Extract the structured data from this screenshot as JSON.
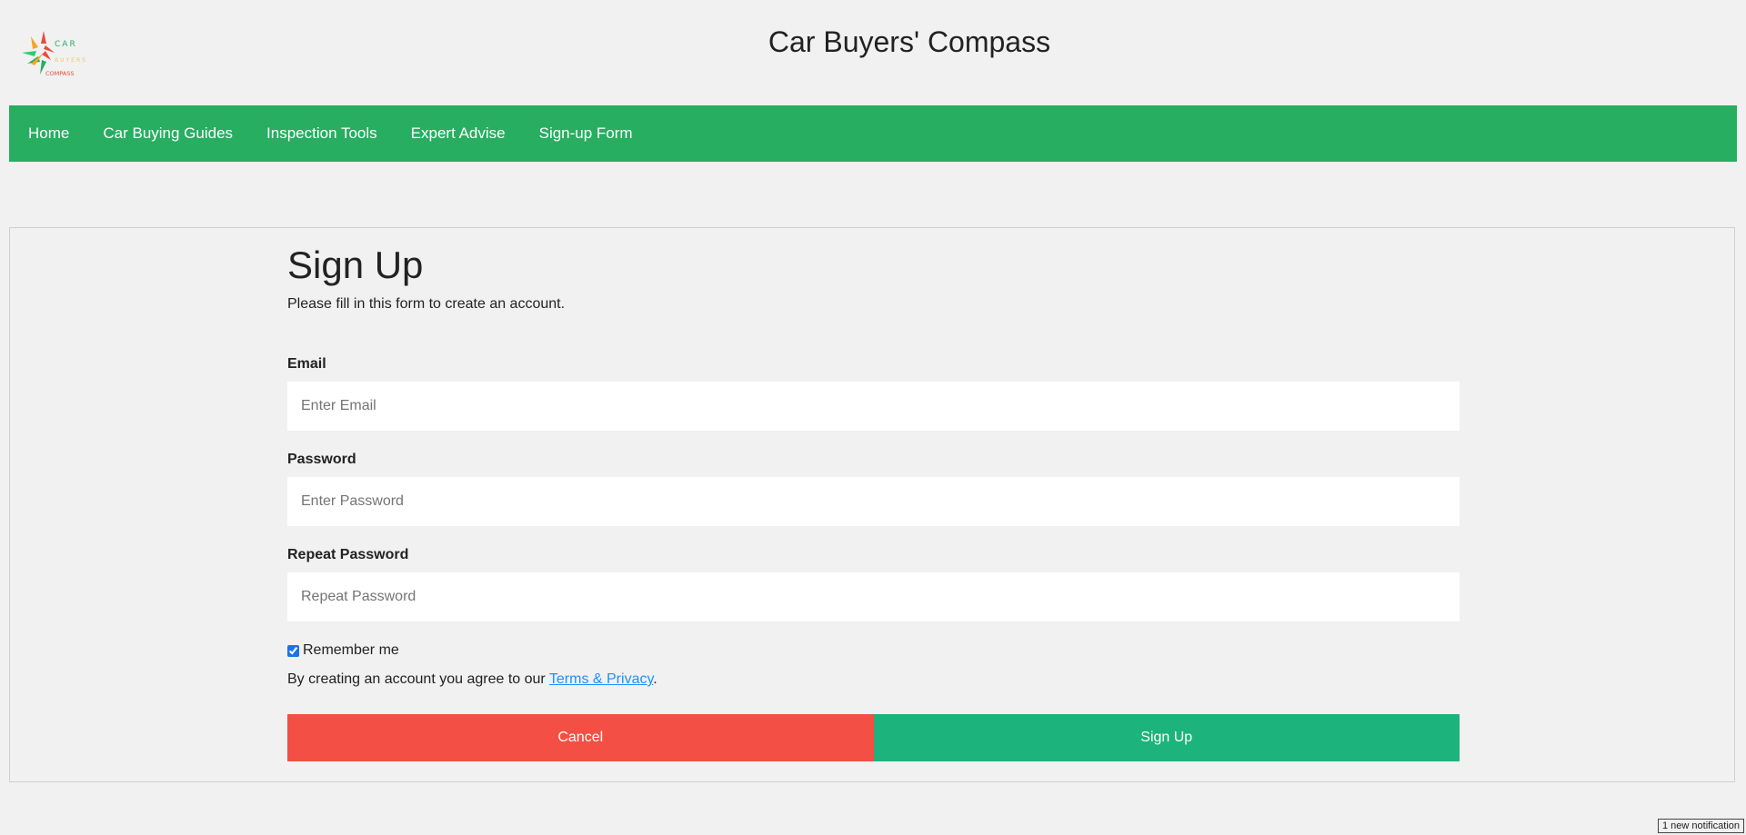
{
  "header": {
    "site_title": "Car Buyers' Compass",
    "logo": {
      "icon": "compass-logo-icon",
      "line1": "CAR",
      "line2": "BUYERS",
      "line3": "COMPASS"
    }
  },
  "nav": {
    "items": [
      {
        "label": "Home"
      },
      {
        "label": "Car Buying Guides"
      },
      {
        "label": "Inspection Tools"
      },
      {
        "label": "Expert Advise"
      },
      {
        "label": "Sign-up Form"
      }
    ]
  },
  "form": {
    "title": "Sign Up",
    "subtitle": "Please fill in this form to create an account.",
    "email_label": "Email",
    "email_placeholder": "Enter Email",
    "email_value": "",
    "password_label": "Password",
    "password_placeholder": "Enter Password",
    "password_value": "",
    "repeat_label": "Repeat Password",
    "repeat_placeholder": "Repeat Password",
    "repeat_value": "",
    "remember_label": "Remember me",
    "remember_checked": true,
    "terms_prefix": "By creating an account you agree to our ",
    "terms_link": "Terms & Privacy",
    "terms_suffix": ".",
    "cancel_label": "Cancel",
    "signup_label": "Sign Up"
  },
  "notification": {
    "text": "1 new notification"
  },
  "colors": {
    "nav_bg": "#27ae60",
    "cancel_bg": "#f44f44",
    "signup_bg": "#1cb37c",
    "link": "#1e90ff",
    "page_bg": "#f1f1f1"
  }
}
